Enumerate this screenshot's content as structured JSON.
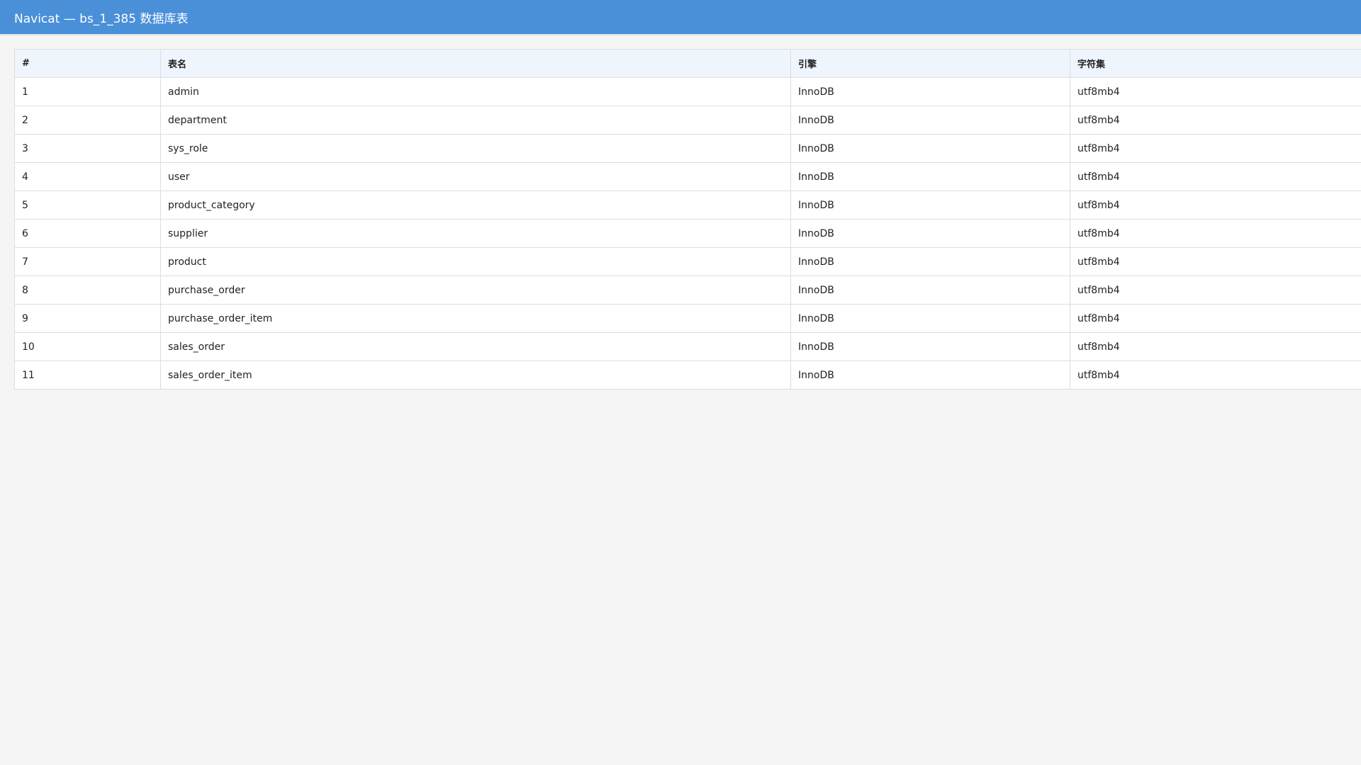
{
  "window": {
    "title": "Navicat — bs_1_385 数据库表"
  },
  "table": {
    "headers": [
      "#",
      "表名",
      "引擎",
      "字符集"
    ],
    "rows": [
      [
        "1",
        "admin",
        "InnoDB",
        "utf8mb4"
      ],
      [
        "2",
        "department",
        "InnoDB",
        "utf8mb4"
      ],
      [
        "3",
        "sys_role",
        "InnoDB",
        "utf8mb4"
      ],
      [
        "4",
        "user",
        "InnoDB",
        "utf8mb4"
      ],
      [
        "5",
        "product_category",
        "InnoDB",
        "utf8mb4"
      ],
      [
        "6",
        "supplier",
        "InnoDB",
        "utf8mb4"
      ],
      [
        "7",
        "product",
        "InnoDB",
        "utf8mb4"
      ],
      [
        "8",
        "purchase_order",
        "InnoDB",
        "utf8mb4"
      ],
      [
        "9",
        "purchase_order_item",
        "InnoDB",
        "utf8mb4"
      ],
      [
        "10",
        "sales_order",
        "InnoDB",
        "utf8mb4"
      ],
      [
        "11",
        "sales_order_item",
        "InnoDB",
        "utf8mb4"
      ]
    ]
  },
  "colors": {
    "titlebar": "#4a90d9",
    "header_bg": "#eef5fd",
    "page_bg": "#f5f5f5"
  }
}
